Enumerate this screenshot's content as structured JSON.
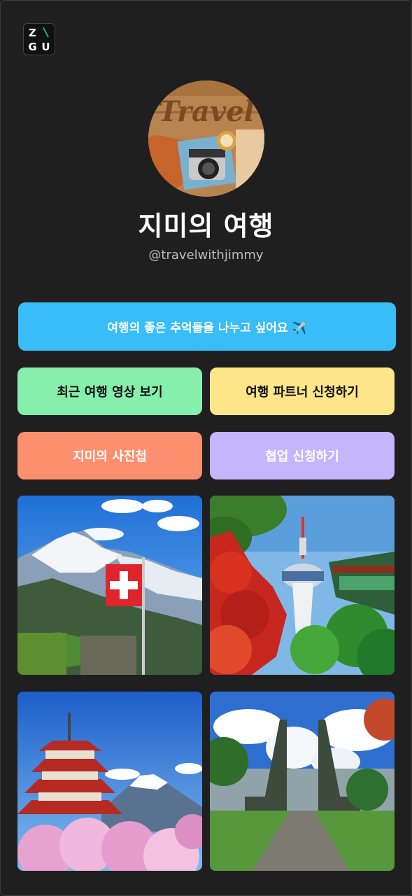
{
  "logo": {
    "letters": [
      "Z",
      "G",
      "U"
    ],
    "slash": "\\"
  },
  "profile": {
    "avatar_text": "Travel",
    "name": "지미의 여행",
    "handle": "@travelwithjimmy"
  },
  "buttons": {
    "main": "여행의 좋은 추억들을 나누고 싶어요 ✈️",
    "recent_videos": "최근 여행 영상 보기",
    "partner_apply": "여행 파트너 신청하기",
    "photo_album": "지미의 사진첩",
    "collab_apply": "협업 신청하기"
  },
  "photos": [
    {
      "name": "swiss-alps",
      "icon": "mountain-flag-image"
    },
    {
      "name": "seoul-tower",
      "icon": "tower-image"
    },
    {
      "name": "japan-fuji",
      "icon": "pagoda-mountain-image"
    },
    {
      "name": "bali-gate",
      "icon": "temple-gate-image"
    }
  ],
  "colors": {
    "background": "#1f1f1f",
    "main_button": "#38bdf8",
    "green_button": "#86efac",
    "yellow_button": "#fde68a",
    "orange_button": "#fb8f6e",
    "purple_button": "#c4b5fd",
    "logo_accent": "#1db954"
  }
}
